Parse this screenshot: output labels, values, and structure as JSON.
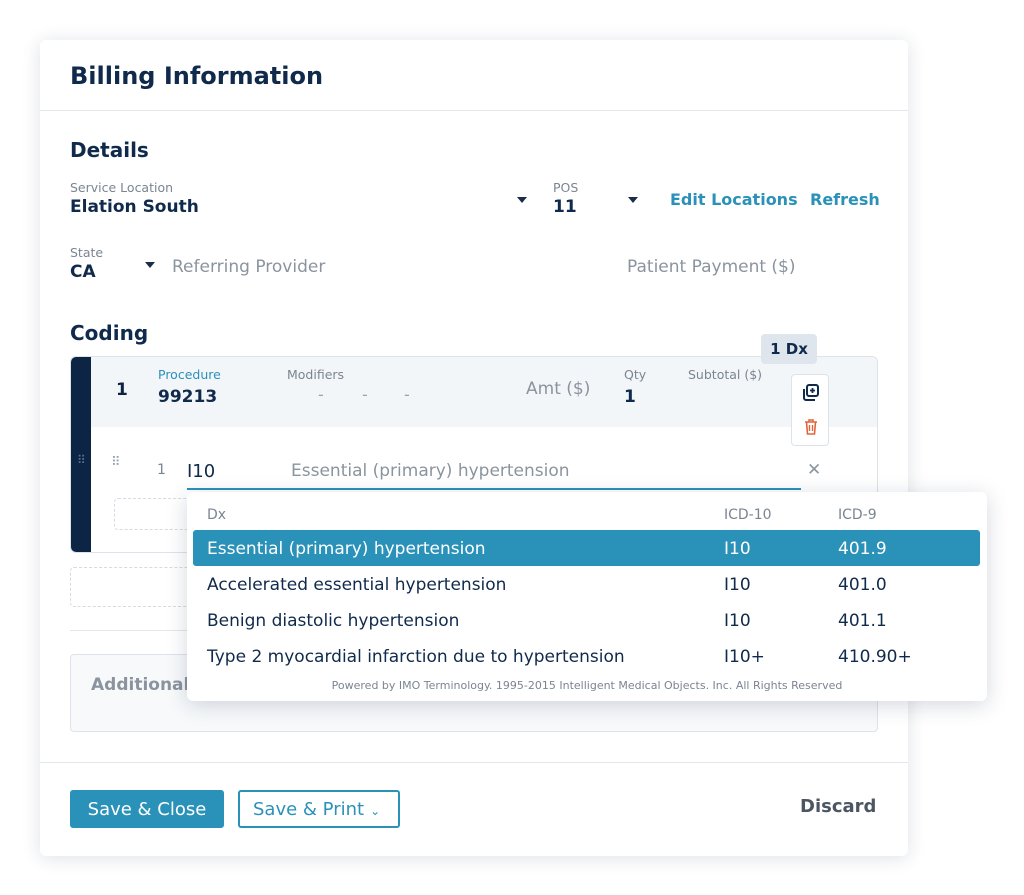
{
  "card": {
    "title": "Billing Information"
  },
  "details": {
    "title": "Details",
    "service_location": {
      "label": "Service Location",
      "value": "Elation South"
    },
    "pos": {
      "label": "POS",
      "value": "11"
    },
    "edit_locations": "Edit Locations",
    "refresh": "Refresh",
    "state": {
      "label": "State",
      "value": "CA"
    },
    "referring_provider_placeholder": "Referring Provider",
    "patient_payment_placeholder": "Patient Payment ($)"
  },
  "coding": {
    "title": "Coding",
    "procedure_row": {
      "index": "1",
      "procedure_label": "Procedure",
      "procedure_value": "99213",
      "modifiers_label": "Modifiers",
      "modifier_dashes": [
        "-",
        "-",
        "-"
      ],
      "amt_placeholder": "Amt ($)",
      "qty_label": "Qty",
      "qty_value": "1",
      "subtotal_label": "Subtotal ($)",
      "dx_badge": "1 Dx"
    },
    "dx_row": {
      "index": "1",
      "code": "I10",
      "description": "Essential (primary) hypertension",
      "clear_symbol": "✕"
    }
  },
  "additional": {
    "placeholder": "Additional I"
  },
  "dropdown": {
    "headers": {
      "dx": "Dx",
      "icd10": "ICD-10",
      "icd9": "ICD-9"
    },
    "rows": [
      {
        "dx": "Essential (primary) hypertension",
        "icd10": "I10",
        "icd9": "401.9"
      },
      {
        "dx": "Accelerated essential hypertension",
        "icd10": "I10",
        "icd9": "401.0"
      },
      {
        "dx": "Benign diastolic hypertension",
        "icd10": "I10",
        "icd9": "401.1"
      },
      {
        "dx": "Type 2 myocardial infarction due to hypertension",
        "icd10": "I10+",
        "icd9": "410.90+"
      }
    ],
    "footer": "Powered by IMO Terminology. 1995-2015 Intelligent Medical Objects. Inc. All Rights Reserved"
  },
  "actions": {
    "save_close": "Save & Close",
    "save_print": "Save & Print",
    "save_print_chevron": "⌄",
    "discard": "Discard"
  },
  "colors": {
    "accent": "#2a91b9",
    "navy": "#0d2545",
    "danger": "#e0663a"
  }
}
